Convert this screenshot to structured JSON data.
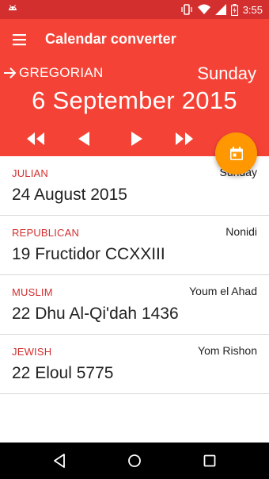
{
  "status_bar": {
    "time": "3:55",
    "icons": [
      "android-icon",
      "vibrate-icon",
      "wifi-icon",
      "signal-icon",
      "battery-icon"
    ]
  },
  "toolbar": {
    "title": "Calendar converter",
    "menu_icon": "hamburger-menu-icon"
  },
  "header": {
    "source_calendar": "GREGORIAN",
    "weekday": "Sunday",
    "date": "6 September 2015",
    "nav_icons": [
      "fast-rewind-icon",
      "previous-icon",
      "next-icon",
      "fast-forward-icon"
    ]
  },
  "fab": {
    "icon": "calendar-icon"
  },
  "conversions": [
    {
      "calendar": "JULIAN",
      "weekday": "Sunday",
      "date": "24 August 2015"
    },
    {
      "calendar": "REPUBLICAN",
      "weekday": "Nonidi",
      "date": "19 Fructidor CCXXIII"
    },
    {
      "calendar": "MUSLIM",
      "weekday": "Youm el Ahad",
      "date": "22 Dhu Al-Qi'dah 1436"
    },
    {
      "calendar": "JEWISH",
      "weekday": "Yom Rishon",
      "date": "22 Eloul 5775"
    }
  ],
  "nav_bar": {
    "icons": [
      "back-icon",
      "home-icon",
      "recents-icon"
    ]
  },
  "colors": {
    "primary": "#f44336",
    "primary_dark": "#d32f2f",
    "accent": "#ff9800"
  }
}
